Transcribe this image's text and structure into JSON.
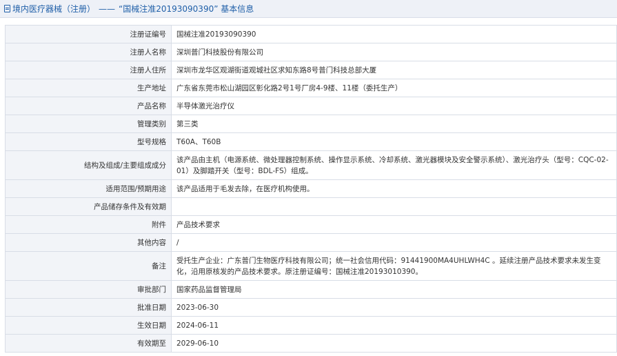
{
  "header": {
    "crumb": "境内医疗器械（注册）",
    "separator": "——",
    "title": "“国械注准20193090390” 基本信息"
  },
  "rows": [
    {
      "label": "注册证编号",
      "value": "国械注准20193090390"
    },
    {
      "label": "注册人名称",
      "value": "深圳普门科技股份有限公司"
    },
    {
      "label": "注册人住所",
      "value": "深圳市龙华区观湖街道观城社区求知东路8号普门科技总部大厦"
    },
    {
      "label": "生产地址",
      "value": "广东省东莞市松山湖园区彰化路2号1号厂房4-9楼、11楼（委托生产）"
    },
    {
      "label": "产品名称",
      "value": "半导体激光治疗仪"
    },
    {
      "label": "管理类别",
      "value": "第三类"
    },
    {
      "label": "型号规格",
      "value": "T60A、T60B"
    },
    {
      "label": "结构及组成/主要组成成分",
      "value": "该产品由主机（电源系统、微处理器控制系统、操作显示系统、冷却系统、激光器模块及安全警示系统）、激光治疗头（型号：CQC-02-01）及脚踏开关（型号：BDL-FS）组成。"
    },
    {
      "label": "适用范围/预期用途",
      "value": "该产品适用于毛发去除，在医疗机构使用。"
    },
    {
      "label": "产品储存条件及有效期",
      "value": ""
    },
    {
      "label": "附件",
      "value": "产品技术要求"
    },
    {
      "label": "其他内容",
      "value": "/"
    },
    {
      "label": "备注",
      "value": "受托生产企业：广东普门生物医疗科技有限公司；统一社会信用代码：91441900MA4UHLWH4C 。延续注册产品技术要求未发生变化，沿用原核发的产品技术要求。原注册证编号：国械注准20193010390。"
    },
    {
      "label": "审批部门",
      "value": "国家药品监督管理局"
    },
    {
      "label": "批准日期",
      "value": "2023-06-30"
    },
    {
      "label": "生效日期",
      "value": "2024-06-11"
    },
    {
      "label": "有效期至",
      "value": "2029-06-10"
    }
  ]
}
